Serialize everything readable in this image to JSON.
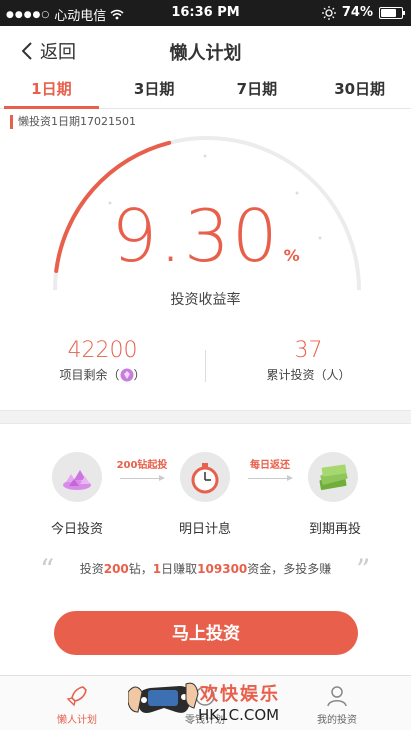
{
  "status_bar": {
    "carrier": "心动电信",
    "time": "16:36 PM",
    "battery": "74%",
    "battery_level": 0.74
  },
  "nav": {
    "back_label": "返回",
    "title": "懒人计划"
  },
  "tabs": [
    {
      "label": "1日期"
    },
    {
      "label": "3日期"
    },
    {
      "label": "7日期"
    },
    {
      "label": "30日期"
    }
  ],
  "product": {
    "name": "懒投资1日期17021501"
  },
  "rate": {
    "value": "9.30",
    "unit": "%",
    "label": "投资收益率",
    "gauge_progress": 0.2
  },
  "stats": {
    "remaining_value": "42200",
    "remaining_label": "项目剩余（",
    "remaining_label_end": "）",
    "investors_value": "37",
    "investors_label": "累计投资（人）"
  },
  "steps": {
    "step1": "今日投资",
    "step2": "明日计息",
    "step3": "到期再投",
    "tag1": "200钻起投",
    "tag2": "每日返还"
  },
  "promo": {
    "p1": "投资",
    "n1": "200",
    "p2": "钻，",
    "n2": "1",
    "p3": "日赚取",
    "n3": "109300",
    "p4": "资金，多投多赚"
  },
  "invest_button": "马上投资",
  "bottom_nav": [
    {
      "label": "懒人计划"
    },
    {
      "label": "零钱计划"
    },
    {
      "label": "我的投资"
    }
  ],
  "watermark": {
    "text": "欢快娱乐",
    "url": "HK1C.COM"
  },
  "colors": {
    "accent": "#e8604c"
  }
}
